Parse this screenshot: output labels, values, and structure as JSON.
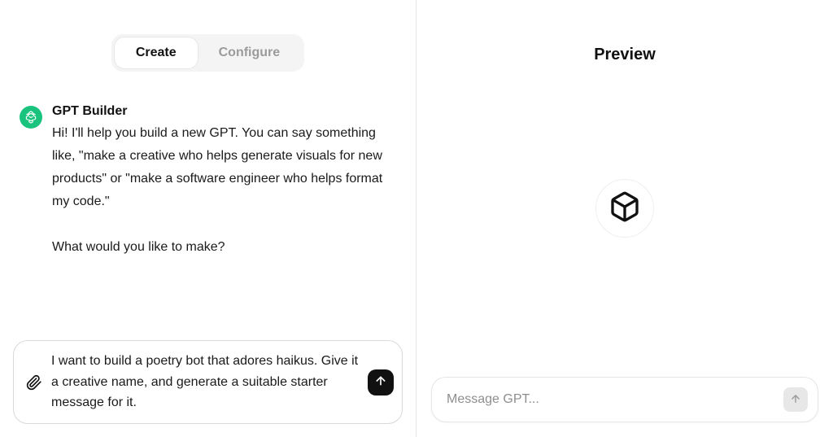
{
  "tabs": {
    "create": "Create",
    "configure": "Configure"
  },
  "builder": {
    "title": "GPT Builder",
    "body": "Hi! I'll help you build a new GPT. You can say something like, \"make a creative who helps generate visuals for new products\" or \"make a software engineer who helps format my code.\"\n\nWhat would you like to make?"
  },
  "composer": {
    "value": "I want to build a poetry bot that adores haikus. Give it a creative name, and generate a suitable starter message for it."
  },
  "preview": {
    "title": "Preview",
    "placeholder": "Message GPT..."
  }
}
